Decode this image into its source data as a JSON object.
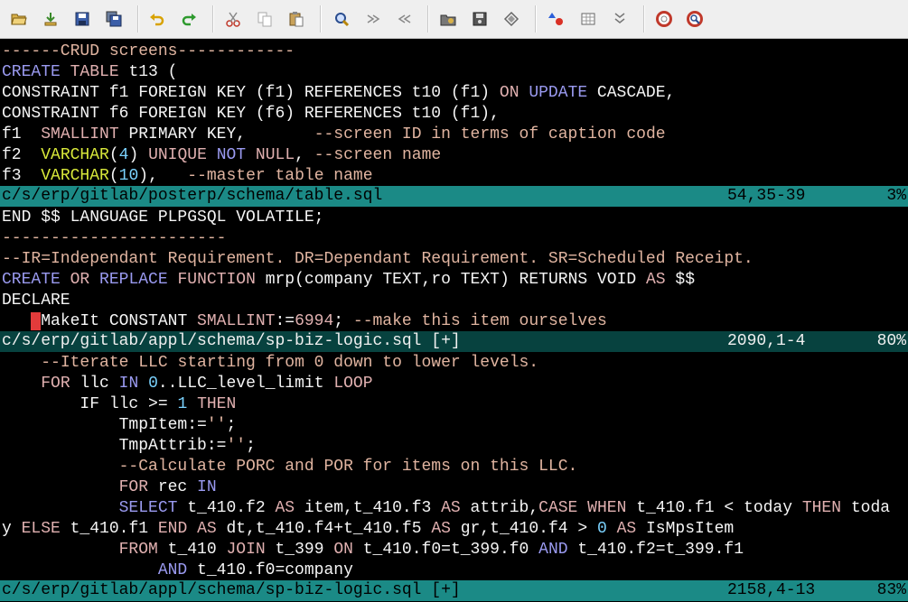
{
  "toolbar": {
    "buttons": [
      {
        "name": "open-file-icon"
      },
      {
        "name": "load-session-icon"
      },
      {
        "name": "save-icon"
      },
      {
        "name": "save-all-icon"
      },
      {
        "name": "undo-icon"
      },
      {
        "name": "redo-icon"
      },
      {
        "name": "cut-icon"
      },
      {
        "name": "copy-icon"
      },
      {
        "name": "paste-icon"
      },
      {
        "name": "find-replace-icon"
      },
      {
        "name": "find-next-icon"
      },
      {
        "name": "find-previous-icon"
      },
      {
        "name": "load-project-icon"
      },
      {
        "name": "save-project-icon"
      },
      {
        "name": "run-script-icon"
      },
      {
        "name": "make-icon"
      },
      {
        "name": "run-ctags-icon"
      },
      {
        "name": "jump-to-tag-icon"
      },
      {
        "name": "help-icon"
      },
      {
        "name": "find-help-icon"
      }
    ]
  },
  "panes": [
    {
      "lines": [
        [
          {
            "t": "------CRUD screens------------",
            "c": "c"
          }
        ],
        [
          {
            "t": "CREATE",
            "c": "k"
          },
          {
            "t": " "
          },
          {
            "t": "TABLE",
            "c": "f"
          },
          {
            "t": " t13 ("
          }
        ],
        [
          {
            "t": "CONSTRAINT f1 FOREIGN KEY (f1) REFERENCES t10 (f1) "
          },
          {
            "t": "ON",
            "c": "f"
          },
          {
            "t": " "
          },
          {
            "t": "UPDATE",
            "c": "k"
          },
          {
            "t": " CASCADE,"
          }
        ],
        [
          {
            "t": "CONSTRAINT f6 FOREIGN KEY (f6) REFERENCES t10 (f1),"
          }
        ],
        [
          {
            "t": "f1  "
          },
          {
            "t": "SMALLINT",
            "c": "f"
          },
          {
            "t": " PRIMARY KEY,       "
          },
          {
            "t": "--screen ID in terms of caption code",
            "c": "c"
          }
        ],
        [
          {
            "t": "f2  "
          },
          {
            "t": "VARCHAR",
            "c": "t"
          },
          {
            "t": "("
          },
          {
            "t": "4",
            "c": "n"
          },
          {
            "t": ") "
          },
          {
            "t": "UNIQUE",
            "c": "f"
          },
          {
            "t": " "
          },
          {
            "t": "NOT",
            "c": "k"
          },
          {
            "t": " "
          },
          {
            "t": "NULL",
            "c": "f"
          },
          {
            "t": ", "
          },
          {
            "t": "--screen name",
            "c": "c"
          }
        ],
        [
          {
            "t": "f3  "
          },
          {
            "t": "VARCHAR",
            "c": "t"
          },
          {
            "t": "("
          },
          {
            "t": "10",
            "c": "n"
          },
          {
            "t": "),   "
          },
          {
            "t": "--master table name",
            "c": "c"
          }
        ]
      ],
      "status": {
        "path": "c/s/erp/gitlab/posterp/schema/table.sql",
        "pos": "54,35-39",
        "pct": "3%"
      }
    },
    {
      "lines": [
        [
          {
            "t": "END $$ LANGUAGE PLPGSQL VOLATILE;"
          }
        ],
        [
          {
            "t": "-----------------------",
            "c": "c"
          }
        ],
        [
          {
            "t": "--IR=Independant Requirement. DR=Dependant Requirement. SR=Scheduled Receipt.",
            "c": "c"
          }
        ],
        [
          {
            "t": "CREATE",
            "c": "k"
          },
          {
            "t": " "
          },
          {
            "t": "OR",
            "c": "f"
          },
          {
            "t": " "
          },
          {
            "t": "REPLACE",
            "c": "k"
          },
          {
            "t": " "
          },
          {
            "t": "FUNCTION",
            "c": "f"
          },
          {
            "t": " mrp(company TEXT,ro TEXT) RETURNS VOID "
          },
          {
            "t": "AS",
            "c": "f"
          },
          {
            "t": " $$"
          }
        ],
        [
          {
            "t": "DECLARE"
          }
        ],
        [
          {
            "t": "   "
          },
          {
            "t": " ",
            "c": "cursor"
          },
          {
            "t": "MakeIt CONSTANT "
          },
          {
            "t": "SMALLINT",
            "c": "f"
          },
          {
            "t": ":="
          },
          {
            "t": "6994",
            "c": "f"
          },
          {
            "t": "; "
          },
          {
            "t": "--make this item ourselves",
            "c": "c"
          }
        ]
      ],
      "status": {
        "path": "c/s/erp/gitlab/appl/schema/sp-biz-logic.sql [+]",
        "pos": "2090,1-4",
        "pct": "80%"
      }
    },
    {
      "lines": [
        [
          {
            "t": "    "
          },
          {
            "t": "--Iterate LLC starting from 0 down to lower levels.",
            "c": "c"
          }
        ],
        [
          {
            "t": "    "
          },
          {
            "t": "FOR",
            "c": "f"
          },
          {
            "t": " llc "
          },
          {
            "t": "IN",
            "c": "k"
          },
          {
            "t": " "
          },
          {
            "t": "0",
            "c": "n"
          },
          {
            "t": "..LLC_level_limit "
          },
          {
            "t": "LOOP",
            "c": "f"
          }
        ],
        [
          {
            "t": "        IF llc >= "
          },
          {
            "t": "1",
            "c": "n"
          },
          {
            "t": " "
          },
          {
            "t": "THEN",
            "c": "f"
          }
        ],
        [
          {
            "t": "            TmpItem:="
          },
          {
            "t": "''",
            "c": "s"
          },
          {
            "t": ";"
          }
        ],
        [
          {
            "t": "            TmpAttrib:="
          },
          {
            "t": "''",
            "c": "s"
          },
          {
            "t": ";"
          }
        ],
        [
          {
            "t": "            "
          },
          {
            "t": "--Calculate PORC and POR for items on this LLC.",
            "c": "c"
          }
        ],
        [
          {
            "t": "            "
          },
          {
            "t": "FOR",
            "c": "f"
          },
          {
            "t": " rec "
          },
          {
            "t": "IN",
            "c": "k"
          }
        ],
        [
          {
            "t": "            "
          },
          {
            "t": "SELECT",
            "c": "k"
          },
          {
            "t": " t_410.f2 "
          },
          {
            "t": "AS",
            "c": "f"
          },
          {
            "t": " item,t_410.f3 "
          },
          {
            "t": "AS",
            "c": "f"
          },
          {
            "t": " attrib,"
          },
          {
            "t": "CASE",
            "c": "f"
          },
          {
            "t": " "
          },
          {
            "t": "WHEN",
            "c": "f"
          },
          {
            "t": " t_410.f1 < today "
          },
          {
            "t": "THEN",
            "c": "f"
          },
          {
            "t": " toda"
          }
        ],
        [
          {
            "t": "y "
          },
          {
            "t": "ELSE",
            "c": "f"
          },
          {
            "t": " t_410.f1 "
          },
          {
            "t": "END",
            "c": "f"
          },
          {
            "t": " "
          },
          {
            "t": "AS",
            "c": "f"
          },
          {
            "t": " dt,t_410.f4+t_410.f5 "
          },
          {
            "t": "AS",
            "c": "f"
          },
          {
            "t": " gr,t_410.f4 > "
          },
          {
            "t": "0",
            "c": "n"
          },
          {
            "t": " "
          },
          {
            "t": "AS",
            "c": "f"
          },
          {
            "t": " IsMpsItem"
          }
        ],
        [
          {
            "t": "            "
          },
          {
            "t": "FROM",
            "c": "f"
          },
          {
            "t": " t_410 "
          },
          {
            "t": "JOIN",
            "c": "f"
          },
          {
            "t": " t_399 "
          },
          {
            "t": "ON",
            "c": "f"
          },
          {
            "t": " t_410.f0=t_399.f0 "
          },
          {
            "t": "AND",
            "c": "k"
          },
          {
            "t": " t_410.f2=t_399.f1"
          }
        ],
        [
          {
            "t": "                "
          },
          {
            "t": "AND",
            "c": "k"
          },
          {
            "t": " t_410.f0=company"
          }
        ]
      ],
      "status": {
        "path": "c/s/erp/gitlab/appl/schema/sp-biz-logic.sql [+]",
        "pos": "2158,4-13",
        "pct": "83%"
      }
    }
  ]
}
